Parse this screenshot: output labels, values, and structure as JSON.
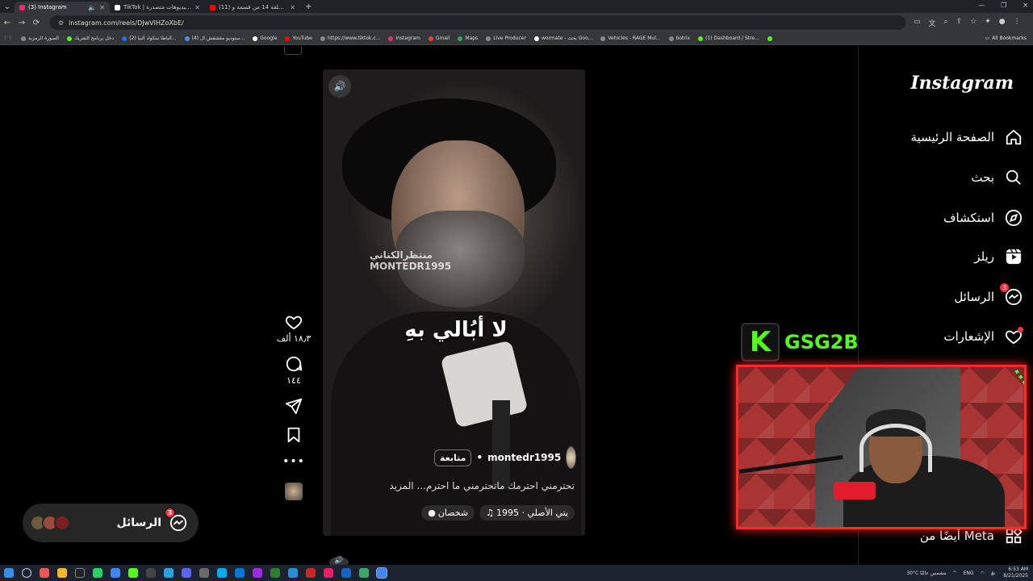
{
  "browser": {
    "tabs": [
      {
        "title": "(3) Instagram",
        "active": true,
        "favicon_color": "#e1306c"
      },
      {
        "title": "TikTok | شاهد فيديوهات متصدرة",
        "active": false,
        "favicon_color": "#ffffff"
      },
      {
        "title": "(11) إعلان الحلقة 14 من قسمة و",
        "active": false,
        "favicon_color": "#ff0000"
      }
    ],
    "url": "instagram.com/reels/DJwVIHZoXbE/",
    "bookmarks": [
      "الصورة الرمزية",
      "دخل برنامج الشريك",
      "(2) الياطا سكواد البيا...",
      "(4) ستوديو مقشقش ال...",
      "Google",
      "YouTube",
      "https://www.tiktok.c...",
      "Instagram",
      "Gmail",
      "Maps",
      "Live Producer",
      "wormate - بحث Goo...",
      "Vehicles - RAGE Mul...",
      "botrix",
      "(1) Dashboard / Stre..."
    ],
    "all_bookmarks": "All Bookmarks"
  },
  "reel": {
    "watermark_line1": "منتظرالكناني",
    "watermark_line2": "MONTEDR1995",
    "overlay_caption": "لا أبُالي بهِ",
    "author": "montedr1995",
    "follow_label": "متابعة",
    "separator": "•",
    "caption": "تحترمني احترمك ماتحترمني ما احترم... المزيد",
    "audio_label": "يتي الأصلي · 1995",
    "people_label": "شخصان"
  },
  "actions": {
    "likes": "١٨٫٣ ألف",
    "comments": "١٤٤"
  },
  "messages_pill": {
    "label": "الرسائل",
    "badge": "3"
  },
  "sidebar": {
    "logo": "Instagram",
    "items": [
      {
        "label": "الصفحة الرئيسية",
        "icon": "home-icon"
      },
      {
        "label": "بحث",
        "icon": "search-icon"
      },
      {
        "label": "استكشاف",
        "icon": "explore-icon"
      },
      {
        "label": "ريلز",
        "icon": "reels-icon"
      },
      {
        "label": "الرسائل",
        "icon": "messenger-icon",
        "badge": "3"
      },
      {
        "label": "الإشعارات",
        "icon": "heart-icon",
        "dot": true
      }
    ],
    "meta_label": "أيضًا من Meta"
  },
  "stream_overlay": {
    "k_letter": "K",
    "channel_name": "GSG2B",
    "accent": "#53fc18",
    "frame_color": "#ff2b2b"
  },
  "taskbar": {
    "weather": "30°C مشمس عالبًا",
    "lang": "ENG",
    "time": "6:53 AM",
    "date": "8/21/2025"
  }
}
